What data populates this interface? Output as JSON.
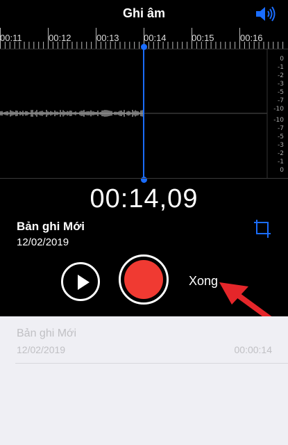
{
  "header": {
    "title": "Ghi âm",
    "speaker_icon": "speaker-volume-icon"
  },
  "timeline": {
    "labels": [
      "00:11",
      "00:12",
      "00:13",
      "00:14",
      "00:15",
      "00:16"
    ]
  },
  "db_scale": {
    "upper": [
      "0",
      "-1",
      "-2",
      "-3",
      "-5",
      "-7",
      "-10"
    ],
    "lower": [
      "-10",
      "-7",
      "-5",
      "-3",
      "-2",
      "-1",
      "0"
    ]
  },
  "player": {
    "elapsed": "00:14,09",
    "recording_name": "Bản ghi Mới",
    "recording_date": "12/02/2019",
    "done_label": "Xong",
    "play_icon": "play-icon",
    "record_icon": "record-icon",
    "trim_icon": "crop-trim-icon"
  },
  "recordings": [
    {
      "name": "Bản ghi Mới",
      "date": "12/02/2019",
      "duration": "00:00:14"
    }
  ],
  "colors": {
    "background": "#000000",
    "playhead": "#1a6dff",
    "record": "#f03a32",
    "annotation_arrow": "#e5262a",
    "list_background": "#efeff4",
    "list_text": "#c0c0c4"
  }
}
